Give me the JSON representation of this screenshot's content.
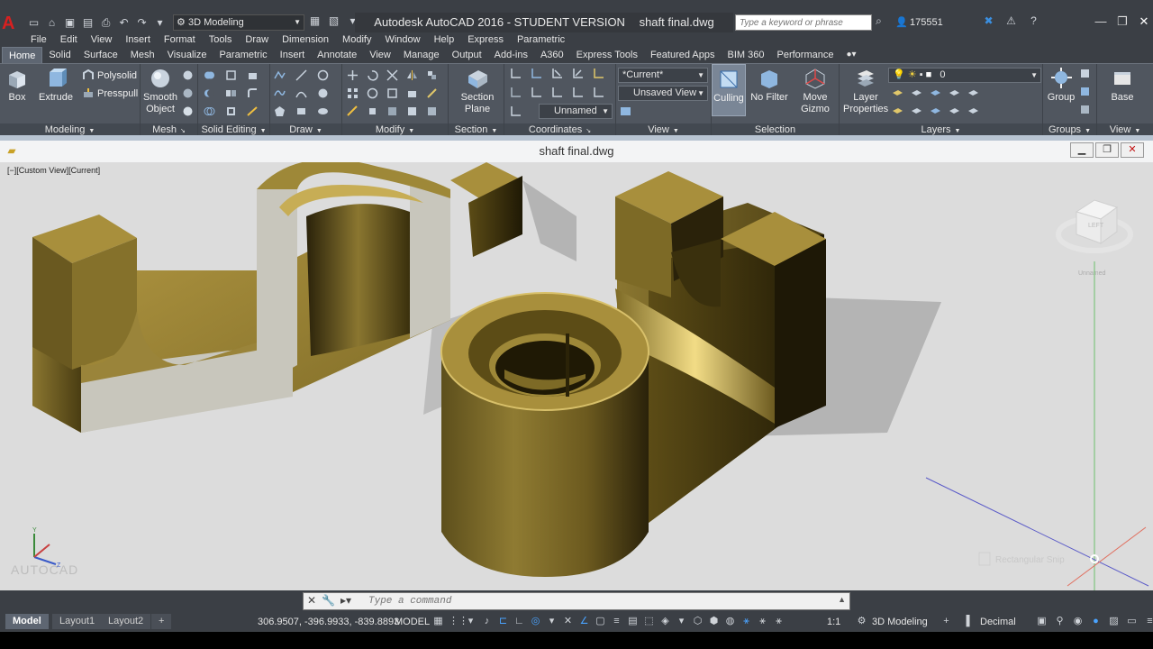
{
  "titlebar": {
    "app_logo": "A",
    "workspace": "3D Modeling",
    "app_title": "Autodesk AutoCAD 2016 - STUDENT VERSION",
    "file_title": "shaft final.dwg",
    "search_placeholder": "Type a keyword or phrase",
    "user": "175551",
    "window_controls": {
      "minimize": "—",
      "restore": "❐",
      "close": "✕"
    }
  },
  "menu": [
    "File",
    "Edit",
    "View",
    "Insert",
    "Format",
    "Tools",
    "Draw",
    "Dimension",
    "Modify",
    "Window",
    "Help",
    "Express",
    "Parametric"
  ],
  "ribbon_tabs": [
    "Home",
    "Solid",
    "Surface",
    "Mesh",
    "Visualize",
    "Parametric",
    "Insert",
    "Annotate",
    "View",
    "Manage",
    "Output",
    "Add-ins",
    "A360",
    "Express Tools",
    "Featured Apps",
    "BIM 360",
    "Performance"
  ],
  "active_tab": "Home",
  "panels": {
    "modeling": {
      "title": "Modeling",
      "box": "Box",
      "extrude": "Extrude",
      "polysolid": "Polysolid",
      "presspull": "Presspull"
    },
    "mesh": {
      "title": "Mesh",
      "smooth_object": [
        "Smooth",
        "Object"
      ]
    },
    "solid_editing": {
      "title": "Solid Editing"
    },
    "draw": {
      "title": "Draw"
    },
    "modify": {
      "title": "Modify"
    },
    "section": {
      "title": "Section",
      "section_plane": [
        "Section",
        "Plane"
      ]
    },
    "coordinates": {
      "title": "Coordinates",
      "ucs_value": "Unnamed"
    },
    "view": {
      "title": "View",
      "visual_style": "*Current*",
      "named_view": "Unsaved View"
    },
    "selection": {
      "title": "Selection",
      "culling": "Culling",
      "no_filter": "No Filter",
      "move_gizmo": [
        "Move",
        "Gizmo"
      ]
    },
    "layers": {
      "title": "Layers",
      "layer_properties": [
        "Layer",
        "Properties"
      ],
      "current_layer": "0"
    },
    "groups": {
      "title": "Groups",
      "group": "Group"
    },
    "view2": {
      "title": "View",
      "base": "Base"
    }
  },
  "document": {
    "title": "shaft final.dwg",
    "view_label": "[−][Custom View][Current]",
    "viewcube_label": "Unnamed",
    "watermark": "AUTOCAD",
    "cursor_tip": "Rectangular Snip"
  },
  "command": {
    "placeholder": "Type a command"
  },
  "status": {
    "layouts": [
      "Model",
      "Layout1",
      "Layout2"
    ],
    "coords": "306.9507, -396.9933, -839.8893",
    "model": "MODEL",
    "scale": "1:1",
    "workspace": "3D Modeling",
    "units": "Decimal"
  },
  "colors": {
    "brass_light": "#e0c76a",
    "brass_mid": "#8f7a2e",
    "brass_dark": "#3a300d",
    "section_face": "#c8c6bc",
    "viewport_bg": "#dcdcdc",
    "ribbon_bg": "#50565f"
  }
}
